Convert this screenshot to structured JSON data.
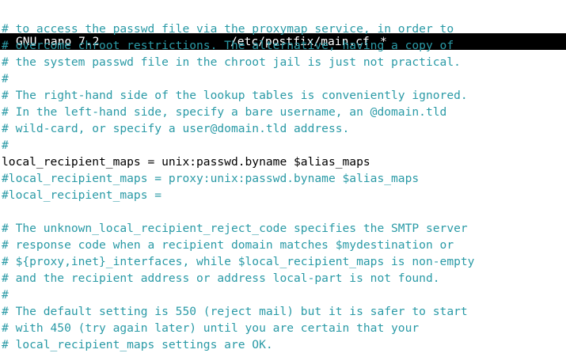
{
  "titlebar": {
    "app_version": "GNU nano 7.2",
    "file_path": "/etc/postfix/main.cf",
    "modified_marker": "*"
  },
  "colors": {
    "titlebar_bg": "#000000",
    "titlebar_fg": "#ffffff",
    "comment": "#2a9aa6",
    "code": "#000000",
    "editor_bg": "#ffffff"
  },
  "editor": {
    "lines": [
      {
        "text": "# to access the passwd file via the proxymap service, in order to",
        "kind": "comment"
      },
      {
        "text": "# overcome chroot restrictions. The alternative, having a copy of",
        "kind": "comment"
      },
      {
        "text": "# the system passwd file in the chroot jail is just not practical.",
        "kind": "comment"
      },
      {
        "text": "#",
        "kind": "comment"
      },
      {
        "text": "# The right-hand side of the lookup tables is conveniently ignored.",
        "kind": "comment"
      },
      {
        "text": "# In the left-hand side, specify a bare username, an @domain.tld",
        "kind": "comment"
      },
      {
        "text": "# wild-card, or specify a user@domain.tld address.",
        "kind": "comment"
      },
      {
        "text": "#",
        "kind": "comment"
      },
      {
        "text": "local_recipient_maps = unix:passwd.byname $alias_maps",
        "kind": "plain"
      },
      {
        "text": "#local_recipient_maps = proxy:unix:passwd.byname $alias_maps",
        "kind": "comment"
      },
      {
        "text": "#local_recipient_maps =",
        "kind": "comment"
      },
      {
        "text": "",
        "kind": "plain"
      },
      {
        "text": "# The unknown_local_recipient_reject_code specifies the SMTP server",
        "kind": "comment"
      },
      {
        "text": "# response code when a recipient domain matches $mydestination or",
        "kind": "comment"
      },
      {
        "text": "# ${proxy,inet}_interfaces, while $local_recipient_maps is non-empty",
        "kind": "comment"
      },
      {
        "text": "# and the recipient address or address local-part is not found.",
        "kind": "comment"
      },
      {
        "text": "#",
        "kind": "comment"
      },
      {
        "text": "# The default setting is 550 (reject mail) but it is safer to start",
        "kind": "comment"
      },
      {
        "text": "# with 450 (try again later) until you are certain that your",
        "kind": "comment"
      },
      {
        "text": "# local_recipient_maps settings are OK.",
        "kind": "comment"
      }
    ]
  }
}
